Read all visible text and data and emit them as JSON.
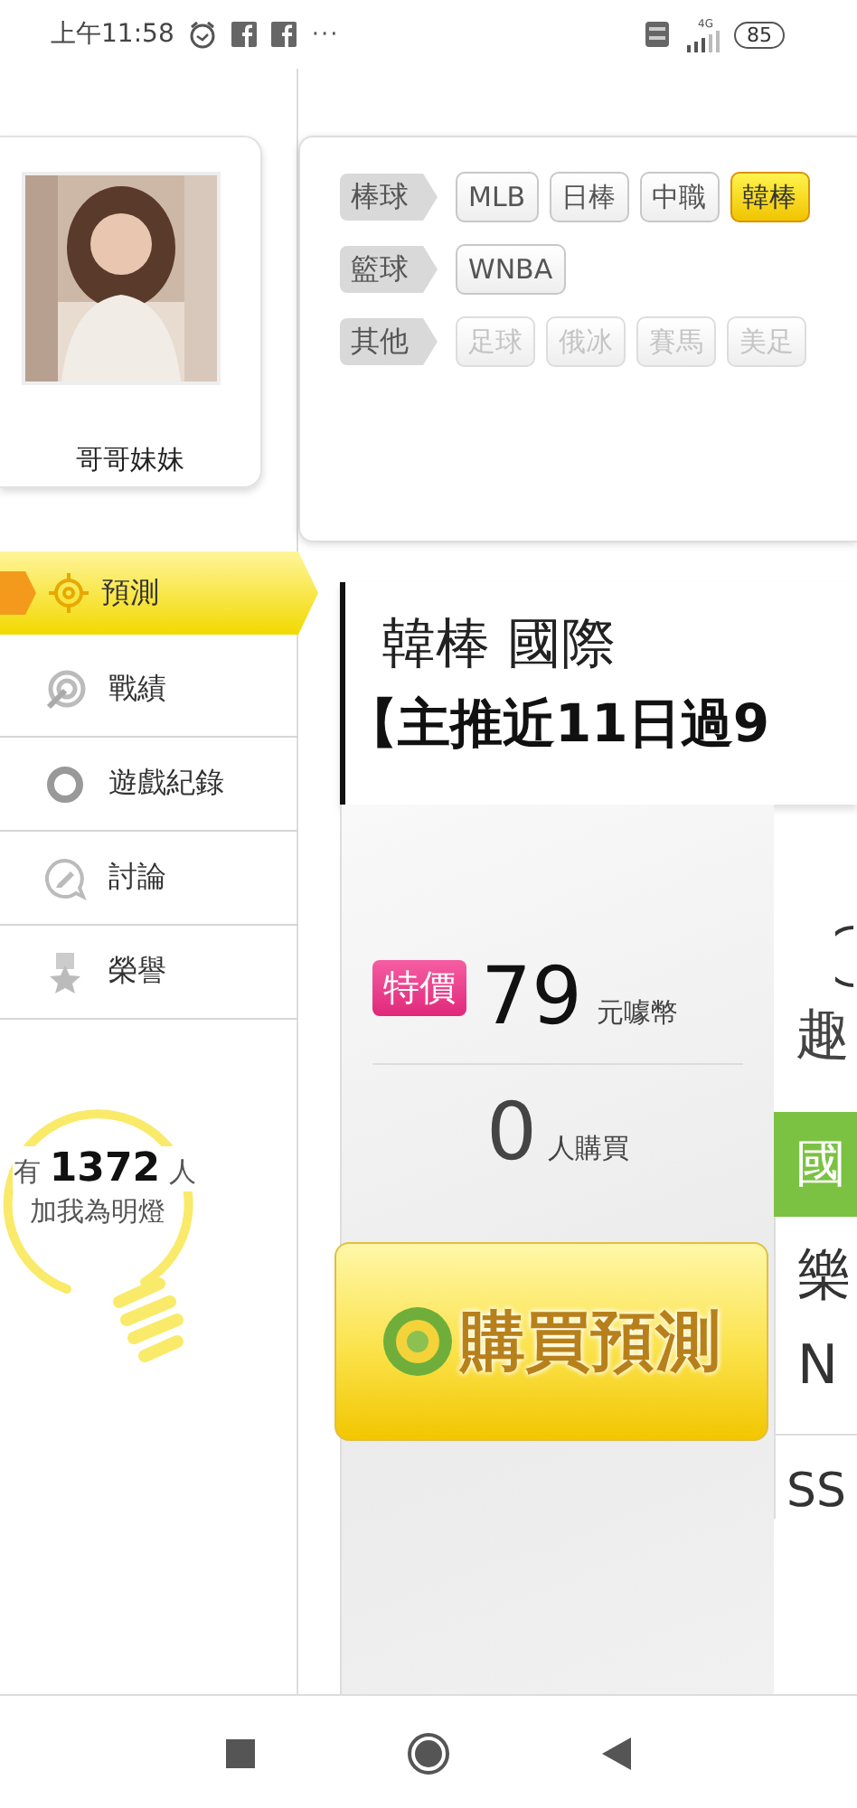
{
  "status_bar": {
    "time": "上午11:58",
    "more": "···",
    "network": "4G",
    "battery": "85"
  },
  "profile": {
    "name": "哥哥妹妹"
  },
  "nav": [
    {
      "label": "預測",
      "selected": true
    },
    {
      "label": "戰績",
      "selected": false
    },
    {
      "label": "遊戲紀錄",
      "selected": false
    },
    {
      "label": "討論",
      "selected": false
    },
    {
      "label": "榮譽",
      "selected": false
    }
  ],
  "fans": {
    "prefix": "有",
    "count": "1372",
    "suffix": "人",
    "caption": "加我為明燈"
  },
  "filters": [
    {
      "category": "棒球",
      "options": [
        {
          "label": "MLB",
          "selected": false,
          "disabled": false
        },
        {
          "label": "日棒",
          "selected": false,
          "disabled": false
        },
        {
          "label": "中職",
          "selected": false,
          "disabled": false
        },
        {
          "label": "韓棒",
          "selected": true,
          "disabled": false
        }
      ]
    },
    {
      "category": "籃球",
      "options": [
        {
          "label": "WNBA",
          "selected": false,
          "disabled": false
        }
      ]
    },
    {
      "category": "其他",
      "options": [
        {
          "label": "足球",
          "selected": false,
          "disabled": true
        },
        {
          "label": "俄冰",
          "selected": false,
          "disabled": true
        },
        {
          "label": "賽馬",
          "selected": false,
          "disabled": true
        },
        {
          "label": "美足",
          "selected": false,
          "disabled": true
        }
      ]
    }
  ],
  "prediction": {
    "title": "韓棒 國際",
    "headline": "【主推近11日過9",
    "price_badge": "特價",
    "price": "79",
    "currency": "元噱幣",
    "buyers": "0",
    "buyers_label": "人購買",
    "buy_button": "購買預測"
  },
  "side_column": {
    "text": "趣",
    "header": "國",
    "lines": [
      "樂",
      "N",
      "SS"
    ]
  }
}
